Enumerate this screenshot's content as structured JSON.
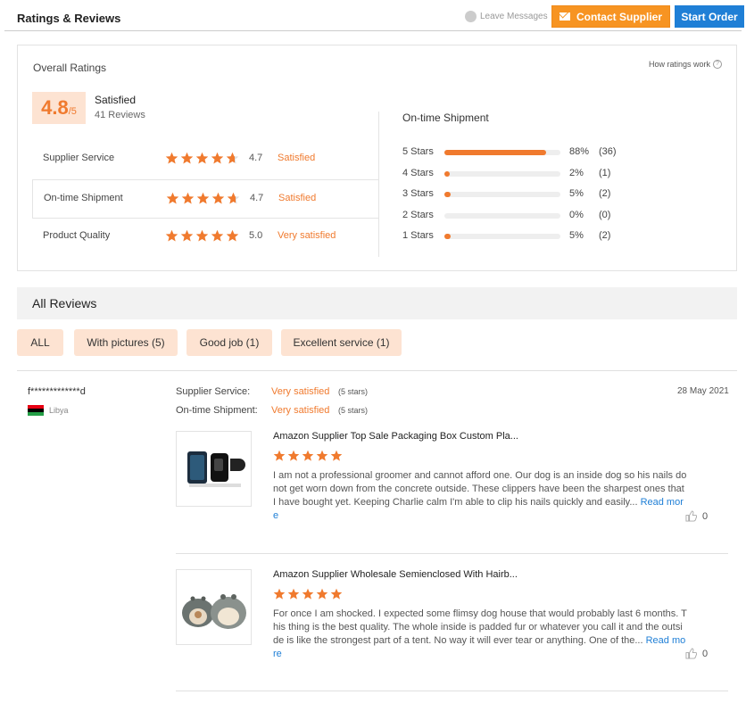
{
  "header": {
    "title": "Ratings & Reviews",
    "leave_messages": "Leave Messages",
    "contact_supplier": "Contact Supplier",
    "start_order": "Start Order"
  },
  "overall": {
    "label": "Overall Ratings",
    "how_ratings_work": "How ratings work",
    "score": "4.8",
    "score_denominator": "/5",
    "satisfaction": "Satisfied",
    "reviews_count": "41 Reviews",
    "rows": [
      {
        "label": "Supplier Service",
        "score": "4.7",
        "word": "Satisfied",
        "stars": 4.7
      },
      {
        "label": "On-time Shipment",
        "score": "4.7",
        "word": "Satisfied",
        "stars": 4.7
      },
      {
        "label": "Product Quality",
        "score": "5.0",
        "word": "Very satisfied",
        "stars": 5.0
      }
    ]
  },
  "shipment": {
    "title": "On-time Shipment",
    "rows": [
      {
        "label": "5 Stars",
        "percent": "88%",
        "count": "(36)",
        "fraction": 0.88
      },
      {
        "label": "4 Stars",
        "percent": "2%",
        "count": "(1)",
        "fraction": 0.02
      },
      {
        "label": "3 Stars",
        "percent": "5%",
        "count": "(2)",
        "fraction": 0.05
      },
      {
        "label": "2 Stars",
        "percent": "0%",
        "count": "(0)",
        "fraction": 0.0
      },
      {
        "label": "1 Stars",
        "percent": "5%",
        "count": "(2)",
        "fraction": 0.05
      }
    ]
  },
  "all_reviews": {
    "title": "All Reviews",
    "filters": [
      "ALL",
      "With pictures (5)",
      "Good job (1)",
      "Excellent service (1)"
    ]
  },
  "review": {
    "reviewer": "f*************d",
    "country": "Libya",
    "date": "28 May 2021",
    "supplier_service_label": "Supplier Service:",
    "supplier_service_value": "Very satisfied",
    "supplier_service_stars": "(5 stars)",
    "shipment_label": "On-time Shipment:",
    "shipment_value": "Very satisfied",
    "shipment_stars": "(5 stars)",
    "items": [
      {
        "title": "Amazon Supplier Top Sale Packaging Box Custom Pla...",
        "stars": 5,
        "text": "I am not a professional groomer and cannot afford one. Our dog is an inside dog so his nails do not get worn down from the concrete outside. These clippers have been the sharpest ones that I have bought yet. Keeping Charlie calm I'm able to clip his nails quickly and easily...",
        "read_more": "Read more",
        "likes": "0"
      },
      {
        "title": "Amazon Supplier Wholesale Semienclosed With Hairb...",
        "stars": 5,
        "text": "For once I am shocked. I expected some flimsy dog house that would probably last 6 months. This thing is the best quality. The whole inside is padded fur or whatever you call it and the outside is like the strongest part of a tent. No way it will ever tear or anything. One of the...",
        "read_more": "Read more",
        "likes": "0"
      }
    ]
  },
  "colors": {
    "accent": "#f07a2e",
    "contact_button": "#f79422",
    "start_button": "#1f7fd6",
    "chip_bg": "#fde3d2"
  }
}
